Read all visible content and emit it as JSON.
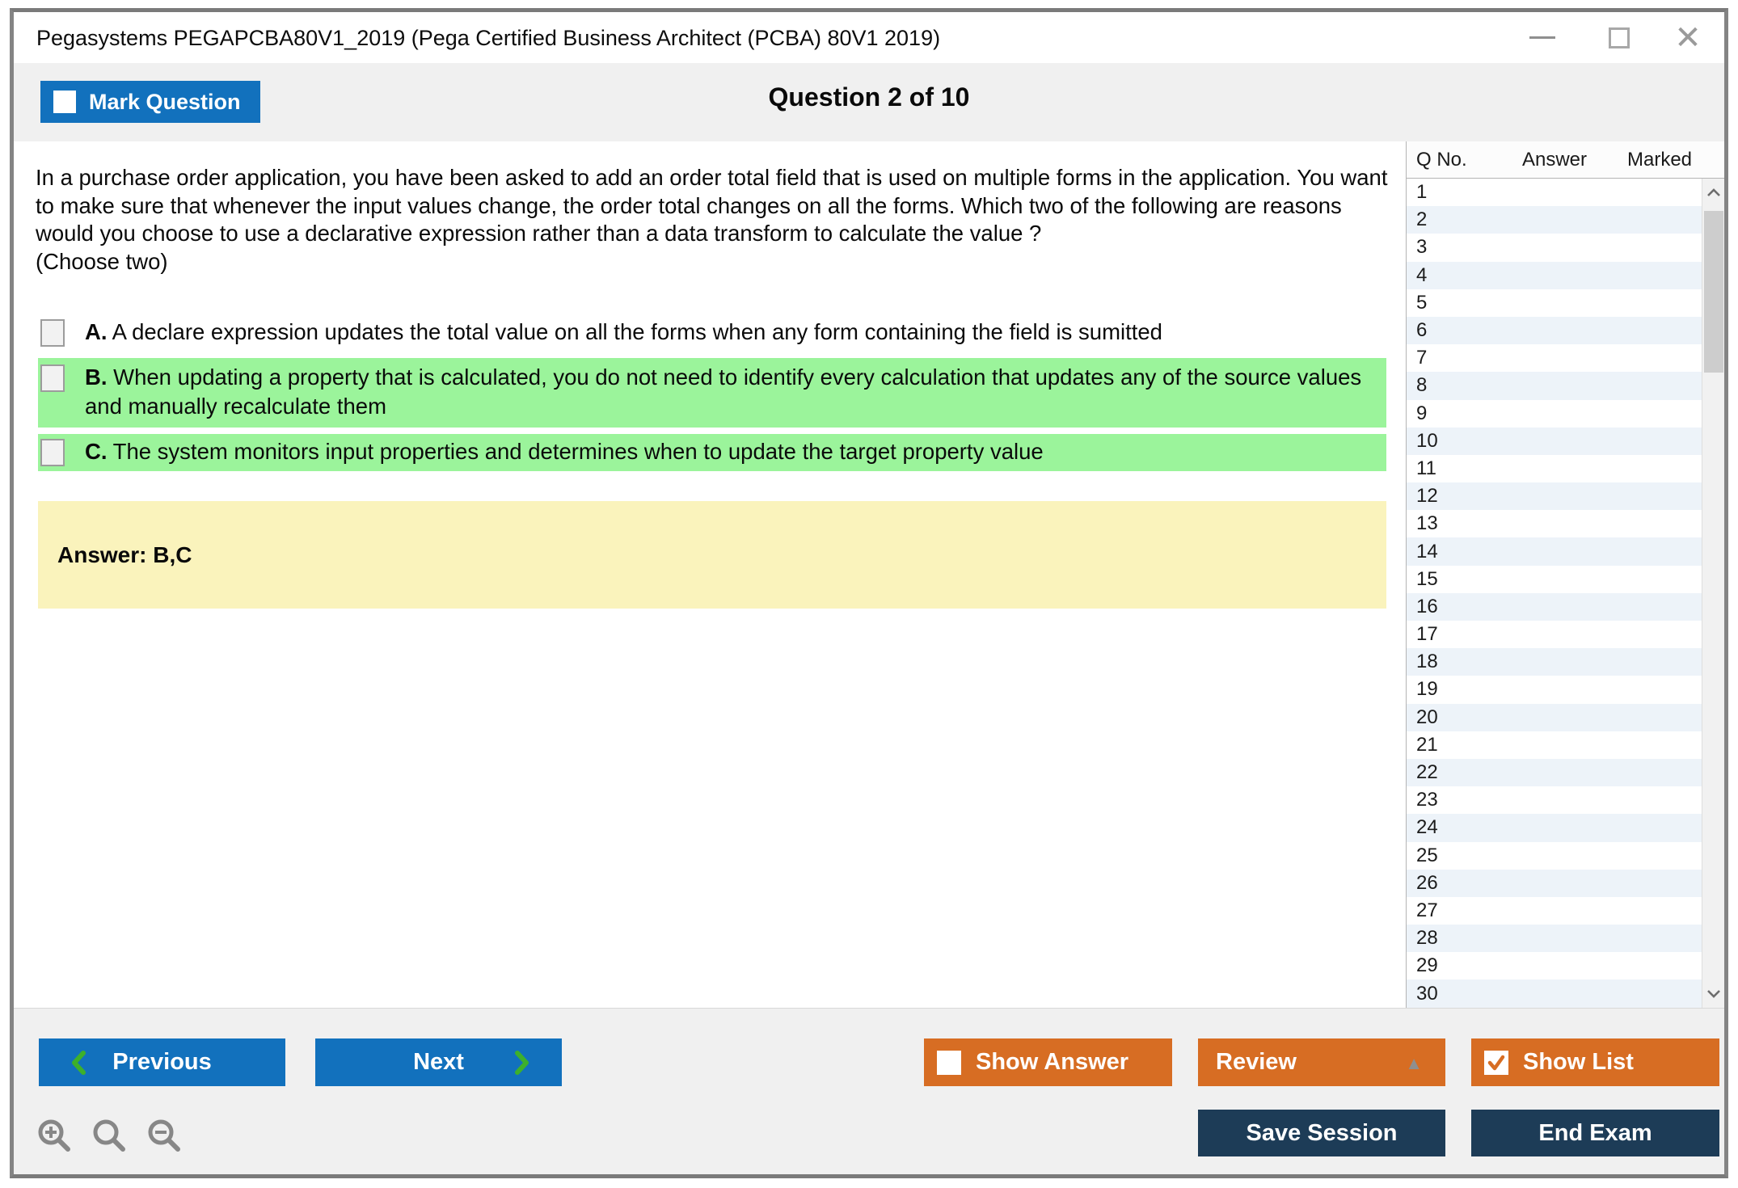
{
  "window": {
    "title": "Pegasystems PEGAPCBA80V1_2019 (Pega Certified Business Architect (PCBA) 80V1 2019)"
  },
  "header": {
    "mark_question_label": "Mark Question",
    "question_counter": "Question 2 of 10"
  },
  "question": {
    "text": "In a purchase order application, you have been asked to add an order total field that is used on multiple forms in the application. You want to make sure that whenever the input values change, the order total changes on all the forms. Which two of the following are reasons would you choose to use a declarative expression rather than a data transform to calculate the value ?",
    "choose_note": "(Choose two)",
    "options": [
      {
        "letter": "A.",
        "text": "A declare expression updates the total value on all the forms when any form containing the field is sumitted",
        "highlighted": false
      },
      {
        "letter": "B.",
        "text": "When updating a property that is calculated, you do not need to identify every calculation that updates any of the source values and manually recalculate them",
        "highlighted": true
      },
      {
        "letter": "C.",
        "text": "The system monitors input properties and determines when to update the target property value",
        "highlighted": true
      }
    ],
    "answer_label": "Answer: B,C"
  },
  "question_list": {
    "columns": [
      "Q No.",
      "Answer",
      "Marked"
    ],
    "rows": [
      1,
      2,
      3,
      4,
      5,
      6,
      7,
      8,
      9,
      10,
      11,
      12,
      13,
      14,
      15,
      16,
      17,
      18,
      19,
      20,
      21,
      22,
      23,
      24,
      25,
      26,
      27,
      28,
      29,
      30
    ]
  },
  "footer": {
    "previous_label": "Previous",
    "next_label": "Next",
    "show_answer_label": "Show Answer",
    "review_label": "Review",
    "show_list_label": "Show List",
    "save_session_label": "Save Session",
    "end_exam_label": "End Exam"
  },
  "colors": {
    "accent_blue": "#1271bd",
    "accent_orange": "#d76d23",
    "navy": "#1d3c57",
    "highlight_green": "#9bf49b",
    "answer_yellow": "#faf3bc",
    "chevron_green": "#3db02c"
  }
}
